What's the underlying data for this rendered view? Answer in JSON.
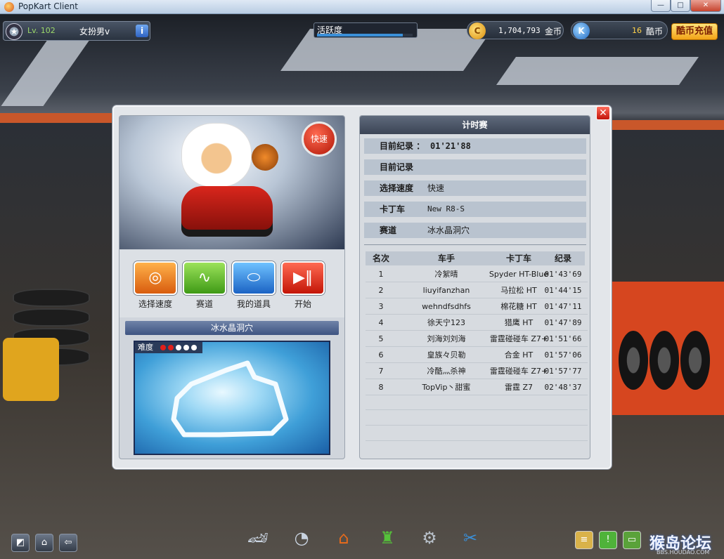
{
  "window": {
    "title": "PopKart Client",
    "buttons": [
      "—",
      "□",
      "✕"
    ]
  },
  "hud": {
    "level": "Lv. 102",
    "nickname": "女扮男v",
    "info_icon": "i",
    "activity_label": "活跃度",
    "activity_progress": 0.9,
    "coins_amount": "1,704,793",
    "coins_unit": "金币",
    "kcoins_amount": "16",
    "kcoins_unit": "酷币",
    "recharge_label": "酷币充值",
    "coin_icon": "coin-icon",
    "kcoin_icon": "kcoin-icon",
    "k_letter": "K",
    "c_letter": "C"
  },
  "left_panel": {
    "speed_badge": "快速",
    "menu": [
      {
        "label": "选择速度",
        "icon": "speed-gauge-icon",
        "color": "#f0902a"
      },
      {
        "label": "赛道",
        "icon": "track-icon",
        "color": "#6cc23a"
      },
      {
        "label": "我的道具",
        "icon": "items-icon",
        "color": "#2f8fe0"
      },
      {
        "label": "开始",
        "icon": "play-icon",
        "color": "#e2301f"
      }
    ],
    "track_name": "冰水晶洞穴",
    "difficulty_label": "难度",
    "difficulty_level": 2,
    "difficulty_max": 5
  },
  "right_panel": {
    "title": "计时赛",
    "best_record_label": "目前纪录 ：",
    "best_record_value": "01'21'88",
    "current_record_label": "目前记录",
    "current_record_value": "",
    "speed_label": "选择速度",
    "speed_value": "快速",
    "kart_label": "卡丁车",
    "kart_value": "New R8-S",
    "track_label": "赛道",
    "track_value": "冰水晶洞穴",
    "ranking_headers": {
      "rank": "名次",
      "driver": "车手",
      "kart": "卡丁车",
      "time": "纪录"
    },
    "ranking": [
      {
        "rank": "1",
        "driver": "冷絮晴",
        "kart": "Spyder HT-Blue",
        "time": "01'43'69"
      },
      {
        "rank": "2",
        "driver": "liuyifanzhan",
        "kart": "马拉松 HT",
        "time": "01'44'15"
      },
      {
        "rank": "3",
        "driver": "wehndfsdhfs",
        "kart": "棉花糖 HT",
        "time": "01'47'11"
      },
      {
        "rank": "4",
        "driver": "徐天宁123",
        "kart": "猎鹰 HT",
        "time": "01'47'89"
      },
      {
        "rank": "5",
        "driver": "刘海刘刘海",
        "kart": "雷霆碰碰车 Z7+",
        "time": "01'51'66"
      },
      {
        "rank": "6",
        "driver": "皇族々贝勒",
        "kart": "合金 HT",
        "time": "01'57'06"
      },
      {
        "rank": "7",
        "driver": "冷酷灬杀神",
        "kart": "雷霆碰碰车 Z7+",
        "time": "01'57'77"
      },
      {
        "rank": "8",
        "driver": "TopVip丶甜蜜",
        "kart": "雷霆 Z7",
        "time": "02'48'37"
      }
    ]
  },
  "bottom": {
    "dock": [
      "kart-icon",
      "speedometer-icon",
      "garage-icon",
      "shop-icon",
      "engine-icon",
      "tools-icon"
    ],
    "watermark": "猴岛论坛",
    "watermark_sub": "BBS.HOUDAO.COM"
  }
}
